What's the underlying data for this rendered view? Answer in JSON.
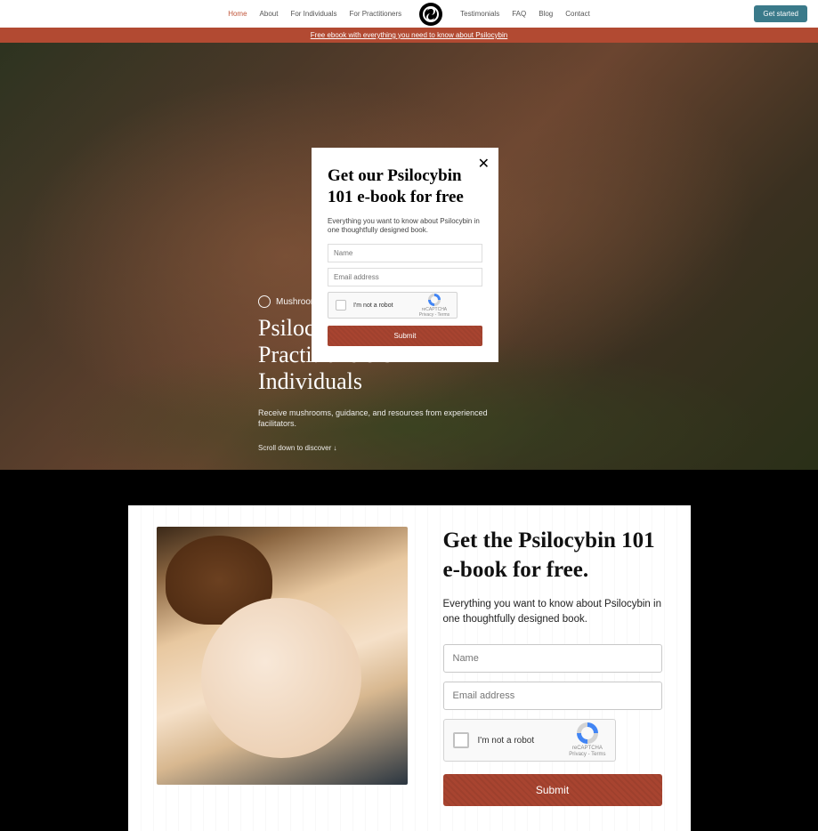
{
  "nav": {
    "home": "Home",
    "about": "About",
    "for_individuals": "For Individuals",
    "for_practitioners": "For Practitioners",
    "testimonials": "Testimonials",
    "faq": "FAQ",
    "blog": "Blog",
    "contact": "Contact",
    "get_started": "Get started"
  },
  "banner": {
    "text": "Free ebook with everything you need to know about Psilocybin"
  },
  "hero": {
    "brand": "Mushroom",
    "title": "Psilocybin for Practitioners & Individuals",
    "desc": "Receive mushrooms, guidance, and resources from experienced facilitators.",
    "scroll": "Scroll down to discover ↓"
  },
  "modal": {
    "title": "Get our Psilocybin 101 e-book for free",
    "desc": "Everything you want to know about Psilocybin in one thoughtfully designed book.",
    "name_placeholder": "Name",
    "email_placeholder": "Email address",
    "recaptcha_label": "I'm not a robot",
    "recaptcha_brand": "reCAPTCHA",
    "recaptcha_terms": "Privacy - Terms",
    "submit": "Submit"
  },
  "section2": {
    "title": "Get the Psilocybin 101 e-book for free.",
    "desc": "Everything you want to know about Psilocybin in one thoughtfully designed book.",
    "name_placeholder": "Name",
    "email_placeholder": "Email address",
    "recaptcha_label": "I'm not a robot",
    "recaptcha_brand": "reCAPTCHA",
    "recaptcha_terms": "Privacy - Terms",
    "submit": "Submit"
  }
}
